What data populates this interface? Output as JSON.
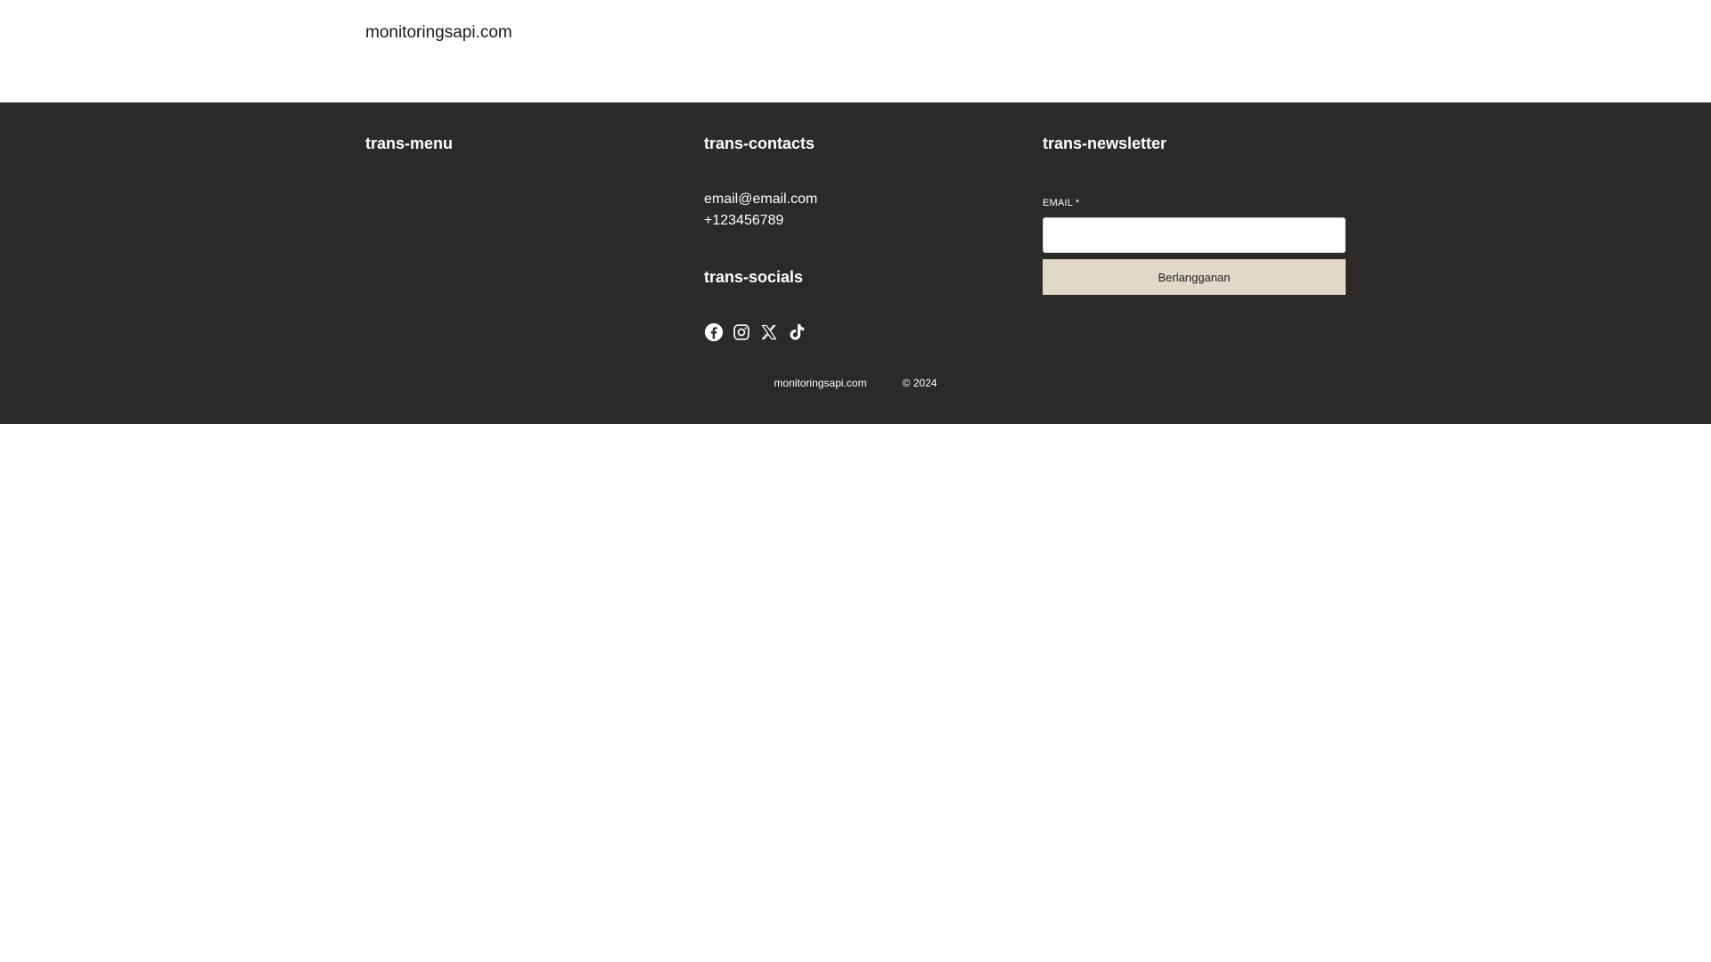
{
  "header": {
    "site_title": "monitoringsapi.com"
  },
  "footer": {
    "menu": {
      "heading": "trans-menu"
    },
    "contacts": {
      "heading": "trans-contacts",
      "email": "email@email.com",
      "phone": "+123456789"
    },
    "socials": {
      "heading": "trans-socials",
      "icons": [
        "facebook-icon",
        "instagram-icon",
        "x-icon",
        "tiktok-icon"
      ]
    },
    "newsletter": {
      "heading": "trans-newsletter",
      "email_label": "EMAIL *",
      "email_value": "",
      "subscribe_label": "Berlangganan"
    },
    "bottom": {
      "site": "monitoringsapi.com",
      "copyright": "© 2024"
    }
  },
  "colors": {
    "footer_bg": "#2b2a28",
    "button_bg": "#e2d8c8"
  }
}
